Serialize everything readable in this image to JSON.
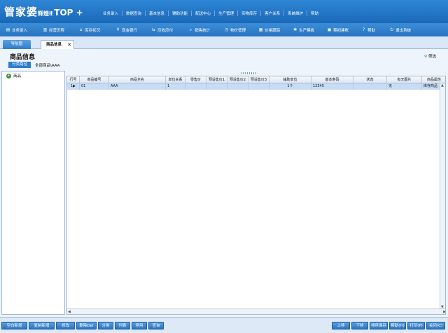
{
  "app": {
    "brand_main": "管家婆",
    "brand_sub": "辉煌Ⅱ",
    "brand_edition": "TOP +"
  },
  "top_menu": [
    "业务录入",
    "数据查询",
    "基本信息",
    "辅助功能",
    "配送中心",
    "生产管理",
    "实物库存",
    "客户关系",
    "系统维护",
    "帮助"
  ],
  "toolbar": [
    {
      "icon": "document-icon",
      "glyph": "▤",
      "label": "业务录入"
    },
    {
      "icon": "chart-icon",
      "glyph": "▥",
      "label": "经营历程"
    },
    {
      "icon": "house-icon",
      "glyph": "⌂",
      "label": "库存状况"
    },
    {
      "icon": "yen-icon",
      "glyph": "¥",
      "label": "现金银行"
    },
    {
      "icon": "arrows-icon",
      "glyph": "⇆",
      "label": "应收应付"
    },
    {
      "icon": "magnifier-icon",
      "glyph": "⌕",
      "label": "销售统计"
    },
    {
      "icon": "clock-icon",
      "glyph": "◷",
      "label": "物价管理"
    },
    {
      "icon": "bars-icon",
      "glyph": "▦",
      "label": "价格跟踪"
    },
    {
      "icon": "gear-icon",
      "glyph": "✱",
      "label": "生产模板"
    },
    {
      "icon": "clipboard-icon",
      "glyph": "▣",
      "label": "期初建账"
    },
    {
      "icon": "help-icon",
      "glyph": "?",
      "label": "帮助"
    },
    {
      "icon": "power-icon",
      "glyph": "⏻",
      "label": "退出系统"
    }
  ],
  "tabs": {
    "nav_label": "导航图",
    "current_label": "商品信息",
    "close_glyph": "✕"
  },
  "header": {
    "title": "商品信息",
    "filter_label": "筛选",
    "filter_glyph": "⚲",
    "path_button": "分类路径",
    "path_text": "全部商品\\AAA"
  },
  "tree": {
    "root_label": "商品",
    "root_glyph": "+"
  },
  "grid": {
    "columns": [
      "行号",
      "商品编号",
      "商品全名",
      "单位关系",
      "零售价",
      "预设售价1",
      "预设售价2",
      "预设售价3",
      "辅助单位",
      "基本条码",
      "状态",
      "有无图片",
      "商品属性"
    ],
    "rows": [
      {
        "row_no": "1",
        "marker": "▶",
        "code": "01",
        "name": "AAA",
        "unit_rel": "1",
        "retail": "",
        "price1": "",
        "price2": "",
        "price3": "",
        "aux_unit": "1个",
        "barcode": "12345",
        "status": "",
        "has_image": "无",
        "attribute": "库存商品"
      }
    ]
  },
  "bottom_buttons": {
    "left": [
      "空白新增",
      "复制新增",
      "修改",
      "删除Del",
      "分类",
      "列表",
      "停用",
      "查询"
    ],
    "right": [
      "上移",
      "下移",
      "排序保存",
      "帮助(H)",
      "打印(P)",
      "关闭(C)"
    ]
  }
}
